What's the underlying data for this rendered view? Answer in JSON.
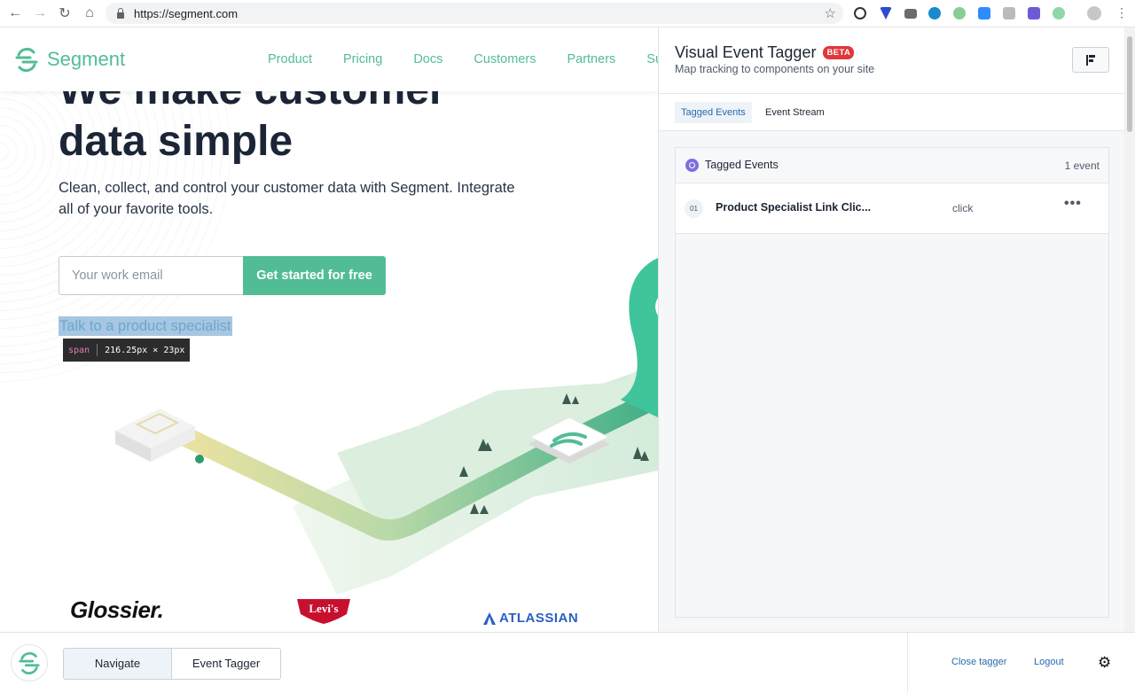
{
  "browser": {
    "url": "https://segment.com"
  },
  "site": {
    "logo_text": "Segment",
    "nav": [
      "Product",
      "Pricing",
      "Docs",
      "Customers",
      "Partners",
      "Su"
    ],
    "hero_title_line1": "We make customer",
    "hero_title_line2": "data simple",
    "hero_subtitle": "Clean, collect, and control your customer data with Segment. Integrate all of your favorite tools.",
    "email_placeholder": "Your work email",
    "cta_label": "Get started for free",
    "talk_link": "Talk to a product specialist",
    "inspect_tooltip": {
      "tag": "span",
      "size": "216.25px × 23px"
    },
    "brands": {
      "glossier": "Glossier.",
      "levis": "Levi's",
      "atlassian": "ATLASSIAN"
    },
    "brand_color": "#52bd94"
  },
  "tagger": {
    "title": "Visual Event Tagger",
    "badge": "BETA",
    "subtitle": "Map tracking to components on your site",
    "tabs": [
      "Tagged Events",
      "Event Stream"
    ],
    "active_tab": "Tagged Events",
    "card": {
      "title": "Tagged Events",
      "count": "1 event",
      "events": [
        {
          "num": "01",
          "name": "Product Specialist Link Clic...",
          "type": "click"
        }
      ]
    }
  },
  "bottom_bar": {
    "segments": [
      "Navigate",
      "Event Tagger"
    ],
    "active_segment": "Navigate",
    "close_label": "Close tagger",
    "logout_label": "Logout"
  }
}
